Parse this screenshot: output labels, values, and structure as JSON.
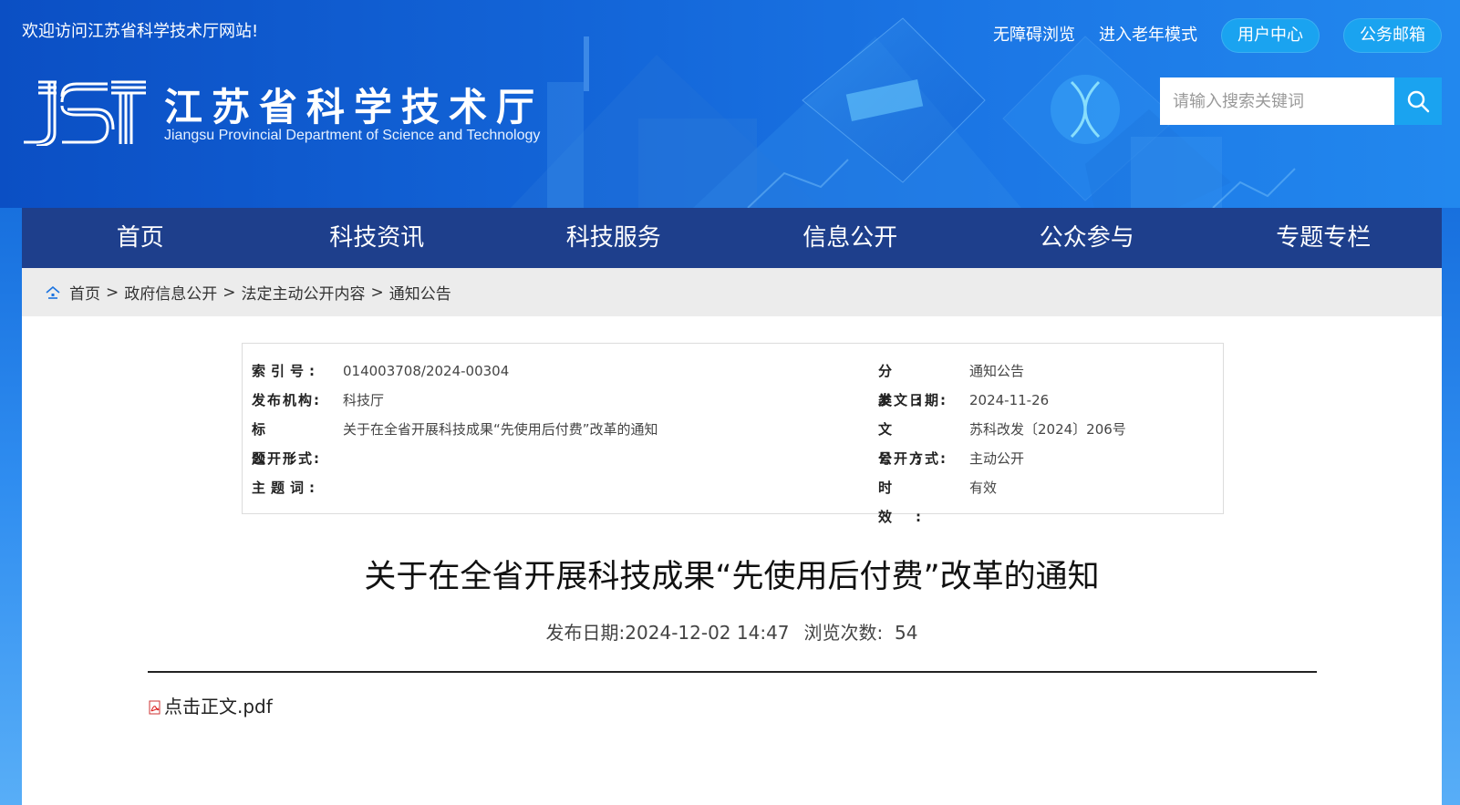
{
  "header": {
    "welcome": "欢迎访问江苏省科学技术厅网站!",
    "links": [
      "无障碍浏览",
      "进入老年模式"
    ],
    "buttons": [
      "用户中心",
      "公务邮箱"
    ],
    "logo_text_cn": "江苏省科学技术厅",
    "logo_text_en": "Jiangsu Provincial Department of Science and Technology",
    "search_placeholder": "请输入搜索关键词"
  },
  "nav": {
    "items": [
      "首页",
      "科技资讯",
      "科技服务",
      "信息公开",
      "公众参与",
      "专题专栏"
    ]
  },
  "breadcrumb": {
    "items": [
      "首页",
      "政府信息公开",
      "法定主动公开内容",
      "通知公告"
    ],
    "separator": ">"
  },
  "meta": {
    "left": [
      {
        "label": "索引号:",
        "value": "014003708/2024-00304"
      },
      {
        "label": "发布机构:",
        "value": "科技厅"
      },
      {
        "label": "标题:",
        "value": "关于在全省开展科技成果“先使用后付费”改革的通知"
      },
      {
        "label": "公开形式:",
        "value": ""
      },
      {
        "label": "主题词:",
        "value": ""
      }
    ],
    "right": [
      {
        "label": "分类:",
        "value": "通知公告"
      },
      {
        "label": "发文日期:",
        "value": "2024-11-26"
      },
      {
        "label": "文号:",
        "value": "苏科改发〔2024〕206号"
      },
      {
        "label": "公开方式:",
        "value": "主动公开"
      },
      {
        "label": "时效:",
        "value": "有效"
      }
    ]
  },
  "article": {
    "title": "关于在全省开展科技成果“先使用后付费”改革的通知",
    "publish_label": "发布日期:",
    "publish_date": "2024-12-02 14:47",
    "views_label": "浏览次数:",
    "views": "54",
    "attachment": "点击正文.pdf"
  },
  "colors": {
    "nav_bg": "#1e3f8c",
    "accent": "#1aa3f0",
    "breadcrumb_bg": "#ececec"
  }
}
